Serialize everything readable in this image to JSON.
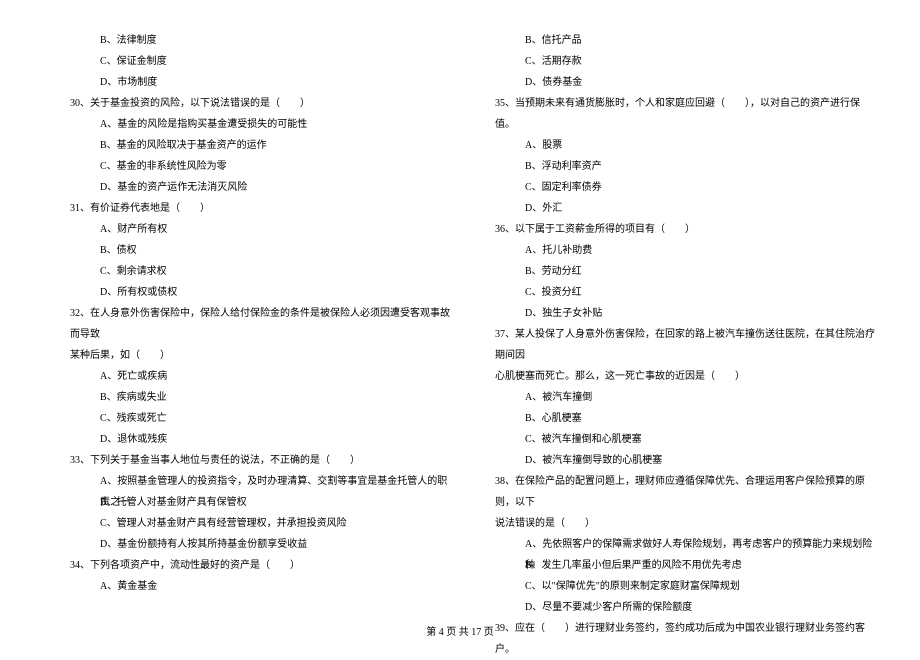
{
  "left_column": {
    "q29_options": {
      "b": "B、法律制度",
      "c": "C、保证金制度",
      "d": "D、市场制度"
    },
    "q30": {
      "stem": "30、关于基金投资的风险，以下说法错误的是（　　）",
      "a": "A、基金的风险是指购买基金遭受损失的可能性",
      "b": "B、基金的风险取决于基金资产的运作",
      "c": "C、基金的非系统性风险为零",
      "d": "D、基金的资产运作无法消灭风险"
    },
    "q31": {
      "stem": "31、有价证券代表地是（　　）",
      "a": "A、财产所有权",
      "b": "B、债权",
      "c": "C、剩余请求权",
      "d": "D、所有权或债权"
    },
    "q32": {
      "stem": "32、在人身意外伤害保险中，保险人给付保险金的条件是被保险人必须因遭受客观事故而导致",
      "cont": "某种后果，如（　　）",
      "a": "A、死亡或疾病",
      "b": "B、疾病或失业",
      "c": "C、残疾或死亡",
      "d": "D、退休或残疾"
    },
    "q33": {
      "stem": "33、下列关于基金当事人地位与责任的说法，不正确的是（　　）",
      "a": "A、按照基金管理人的投资指令，及时办理清算、交割等事宜是基金托管人的职责之一",
      "b": "B、托管人对基金财产具有保管权",
      "c": "C、管理人对基金财产具有经营管理权，并承担投资风险",
      "d": "D、基金份额持有人按其所持基金份额享受收益"
    },
    "q34": {
      "stem": "34、下列各项资产中，流动性最好的资产是（　　）",
      "a": "A、黄金基金"
    }
  },
  "right_column": {
    "q34_options": {
      "b": "B、信托产品",
      "c": "C、活期存款",
      "d": "D、债券基金"
    },
    "q35": {
      "stem": "35、当预期未来有通货膨胀时，个人和家庭应回避（　　），以对自己的资产进行保值。",
      "a": "A、股票",
      "b": "B、浮动利率资产",
      "c": "C、固定利率债券",
      "d": "D、外汇"
    },
    "q36": {
      "stem": "36、以下属于工资薪金所得的项目有（　　）",
      "a": "A、托儿补助费",
      "b": "B、劳动分红",
      "c": "C、投资分红",
      "d": "D、独生子女补贴"
    },
    "q37": {
      "stem": "37、某人投保了人身意外伤害保险，在回家的路上被汽车撞伤送往医院，在其住院治疗期间因",
      "cont": "心肌梗塞而死亡。那么，这一死亡事故的近因是（　　）",
      "a": "A、被汽车撞倒",
      "b": "B、心肌梗塞",
      "c": "C、被汽车撞倒和心肌梗塞",
      "d": "D、被汽车撞倒导致的心肌梗塞"
    },
    "q38": {
      "stem": "38、在保险产品的配置问题上，理财师应遵循保障优先、合理运用客户保险预算的原则，以下",
      "cont": "说法错误的是（　　）",
      "a": "A、先依照客户的保障需求做好人寿保险规划，再考虑客户的预算能力来规划险种",
      "b": "B、发生几率虽小但后果严重的风险不用优先考虑",
      "c": "C、以\"保障优先\"的原则来制定家庭财富保障规划",
      "d": "D、尽量不要减少客户所需的保险额度"
    },
    "q39": {
      "stem": "39、应在（　　）进行理财业务签约，签约成功后成为中国农业银行理财业务签约客户。"
    }
  },
  "footer": "第 4 页 共 17 页"
}
